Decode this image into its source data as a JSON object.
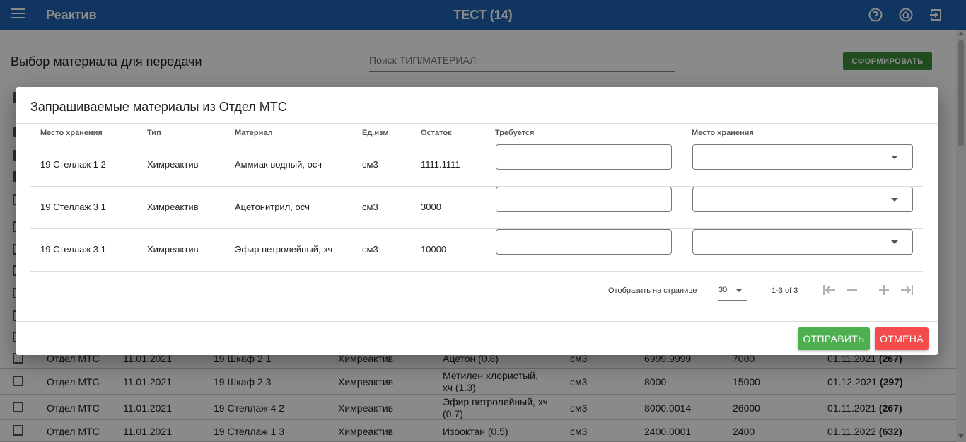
{
  "appbar": {
    "app_name": "Реактив",
    "title": "ТЕСТ (14)",
    "icons": [
      "menu-icon",
      "help-icon",
      "home-icon",
      "logout-icon"
    ]
  },
  "page": {
    "heading": "Выбор материала для передачи",
    "search_placeholder": "Поиск ТИП/МАТЕРИАЛ",
    "form_button": "СФОРМИРОВАТЬ",
    "rows": [
      {
        "dept": "Отдел МТС",
        "date": "11.01.2021",
        "place": "19 Шкаф 2 1",
        "type": "Химреактив",
        "material": "Ацетон (0.8)",
        "unit": "см3",
        "rest": "6999.9999",
        "qty": "7000",
        "expiry": "01.11.2021",
        "days": "(267)"
      },
      {
        "dept": "Отдел МТС",
        "date": "11.01.2021",
        "place": "19 Шкаф 2 3",
        "type": "Химреактив",
        "material": "Метилен хлористый, хч (1.3)",
        "unit": "см3",
        "rest": "8000",
        "qty": "15000",
        "expiry": "01.12.2021",
        "days": "(297)"
      },
      {
        "dept": "Отдел МТС",
        "date": "11.01.2021",
        "place": "19 Стеллаж 4 2",
        "type": "Химреактив",
        "material": "Эфир петролейный, хч (0.7)",
        "unit": "см3",
        "rest": "8000.0014",
        "qty": "26000",
        "expiry": "01.11.2021",
        "days": "(267)"
      },
      {
        "dept": "Отдел МТС",
        "date": "11.01.2021",
        "place": "19 Стеллаж 1 3",
        "type": "Химреактив",
        "material": "Изооктан (0.5)",
        "unit": "см3",
        "rest": "2400.0001",
        "qty": "2400",
        "expiry": "01.11.2022",
        "days": "(632)"
      }
    ]
  },
  "dialog": {
    "title": "Запрашиваемые материалы из Отдел МТС",
    "headers": [
      "Место хранения",
      "Тип",
      "Материал",
      "Ед.изм",
      "Остаток",
      "Требуется",
      "Место хранения"
    ],
    "rows": [
      {
        "place": "19 Стеллаж 1 2",
        "type": "Химреактив",
        "material": "Аммиак водный, осч",
        "unit": "см3",
        "rest": "1111.1111",
        "required": "",
        "target": ""
      },
      {
        "place": "19 Стеллаж 3 1",
        "type": "Химреактив",
        "material": "Ацетонитрил, осч",
        "unit": "см3",
        "rest": "3000",
        "required": "",
        "target": ""
      },
      {
        "place": "19 Стеллаж 3 1",
        "type": "Химреактив",
        "material": "Эфир петролейный, хч",
        "unit": "см3",
        "rest": "10000",
        "required": "",
        "target": ""
      }
    ],
    "per_page_label": "Отобразить на странице",
    "per_page_value": "30",
    "range": "1-3 of 3",
    "pager_icons": [
      "first-page-icon",
      "prev-page-icon",
      "next-page-icon",
      "last-page-icon"
    ],
    "send_button": "ОТПРАВИТЬ",
    "cancel_button": "ОТМЕНА"
  },
  "colors": {
    "appbar": "#1e63b4",
    "form_button": "#3c8f3c",
    "send_button": "#4caf50",
    "cancel_button": "#f44c4c"
  }
}
